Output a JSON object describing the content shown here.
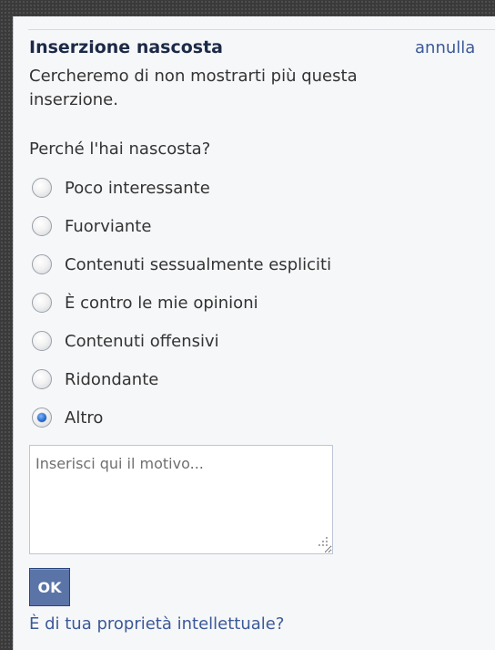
{
  "header": {
    "title": "Inserzione nascosta",
    "undo_label": "annulla"
  },
  "message": "Cercheremo di non mostrarti più questa inserzione.",
  "question": "Perché l'hai nascosta?",
  "options": [
    {
      "label": "Poco interessante",
      "selected": false
    },
    {
      "label": "Fuorviante",
      "selected": false
    },
    {
      "label": "Contenuti sessualmente espliciti",
      "selected": false
    },
    {
      "label": "È contro le mie opinioni",
      "selected": false
    },
    {
      "label": "Contenuti offensivi",
      "selected": false
    },
    {
      "label": "Ridondante",
      "selected": false
    },
    {
      "label": "Altro",
      "selected": true
    }
  ],
  "reason_input": {
    "placeholder": "Inserisci qui il motivo...",
    "value": ""
  },
  "ok_label": "OK",
  "ip_link": "È di tua proprietà intellettuale?",
  "colors": {
    "link": "#3b5998",
    "button_bg": "#5b74a8",
    "panel_bg": "#f6f7f9"
  }
}
